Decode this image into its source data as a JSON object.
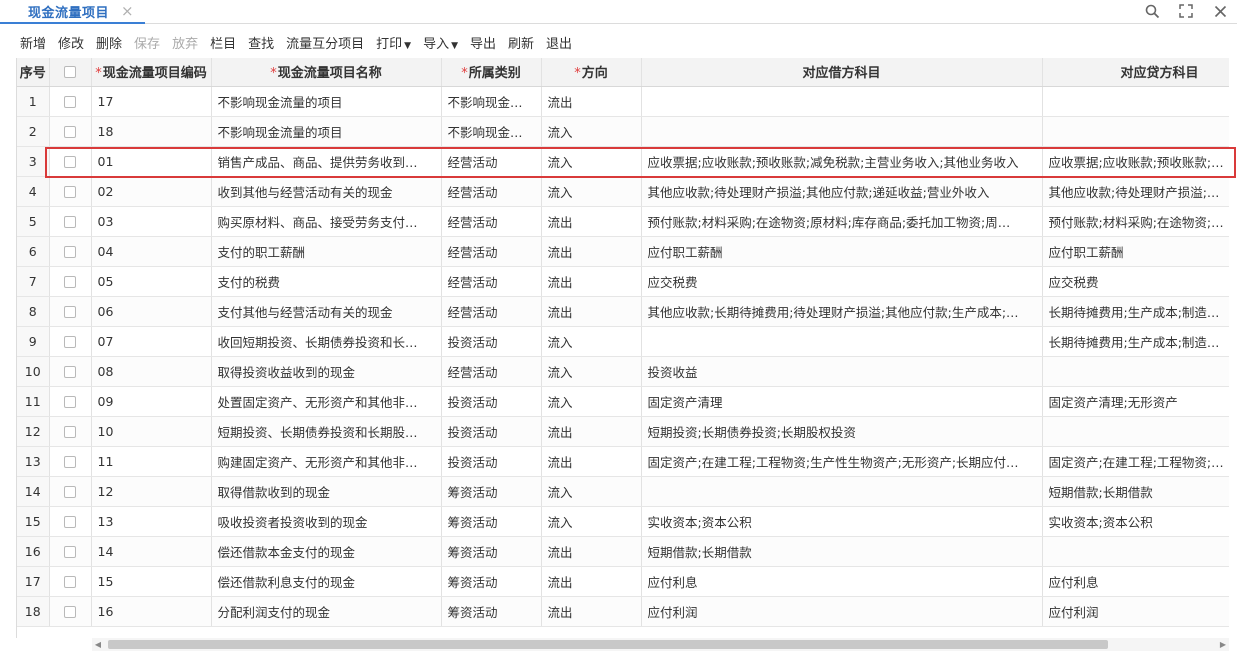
{
  "tab": {
    "title": "现金流量项目",
    "close": "×"
  },
  "toolbar": [
    {
      "label": "新增",
      "disabled": false,
      "dropdown": false
    },
    {
      "label": "修改",
      "disabled": false,
      "dropdown": false
    },
    {
      "label": "删除",
      "disabled": false,
      "dropdown": false
    },
    {
      "label": "保存",
      "disabled": true,
      "dropdown": false
    },
    {
      "label": "放弃",
      "disabled": true,
      "dropdown": false
    },
    {
      "label": "栏目",
      "disabled": false,
      "dropdown": false
    },
    {
      "label": "查找",
      "disabled": false,
      "dropdown": false
    },
    {
      "label": "流量互分项目",
      "disabled": false,
      "dropdown": false
    },
    {
      "label": "打印",
      "disabled": false,
      "dropdown": true
    },
    {
      "label": "导入",
      "disabled": false,
      "dropdown": true
    },
    {
      "label": "导出",
      "disabled": false,
      "dropdown": false
    },
    {
      "label": "刷新",
      "disabled": false,
      "dropdown": false
    },
    {
      "label": "退出",
      "disabled": false,
      "dropdown": false
    }
  ],
  "columns": [
    {
      "key": "seq",
      "label": "序号",
      "required": false
    },
    {
      "key": "chk",
      "label": "",
      "required": false
    },
    {
      "key": "code",
      "label": "现金流量项目编码",
      "required": true
    },
    {
      "key": "name",
      "label": "现金流量项目名称",
      "required": true
    },
    {
      "key": "category",
      "label": "所属类别",
      "required": true
    },
    {
      "key": "direction",
      "label": "方向",
      "required": true
    },
    {
      "key": "debit",
      "label": "对应借方科目",
      "required": false
    },
    {
      "key": "credit",
      "label": "对应贷方科目",
      "required": false
    }
  ],
  "rows": [
    {
      "seq": "1",
      "code": "17",
      "name": "不影响现金流量的项目",
      "category": "不影响现金…",
      "direction": "流出",
      "debit": "",
      "credit": ""
    },
    {
      "seq": "2",
      "code": "18",
      "name": "不影响现金流量的项目",
      "category": "不影响现金…",
      "direction": "流入",
      "debit": "",
      "credit": ""
    },
    {
      "seq": "3",
      "code": "01",
      "name": "销售产成品、商品、提供劳务收到…",
      "category": "经营活动",
      "direction": "流入",
      "debit": "应收票据;应收账款;预收账款;减免税款;主营业务收入;其他业务收入",
      "credit": "应收票据;应收账款;预收账款;…"
    },
    {
      "seq": "4",
      "code": "02",
      "name": "收到其他与经营活动有关的现金",
      "category": "经营活动",
      "direction": "流入",
      "debit": "其他应收款;待处理财产损溢;其他应付款;递延收益;营业外收入",
      "credit": "其他应收款;待处理财产损溢;…"
    },
    {
      "seq": "5",
      "code": "03",
      "name": "购买原材料、商品、接受劳务支付…",
      "category": "经营活动",
      "direction": "流出",
      "debit": "预付账款;材料采购;在途物资;原材料;库存商品;委托加工物资;周…",
      "credit": "预付账款;材料采购;在途物资;…"
    },
    {
      "seq": "6",
      "code": "04",
      "name": "支付的职工薪酬",
      "category": "经营活动",
      "direction": "流出",
      "debit": "应付职工薪酬",
      "credit": "应付职工薪酬"
    },
    {
      "seq": "7",
      "code": "05",
      "name": "支付的税费",
      "category": "经营活动",
      "direction": "流出",
      "debit": "应交税费",
      "credit": "应交税费"
    },
    {
      "seq": "8",
      "code": "06",
      "name": "支付其他与经营活动有关的现金",
      "category": "经营活动",
      "direction": "流出",
      "debit": "其他应收款;长期待摊费用;待处理财产损溢;其他应付款;生产成本;…",
      "credit": "长期待摊费用;生产成本;制造…"
    },
    {
      "seq": "9",
      "code": "07",
      "name": "收回短期投资、长期债券投资和长…",
      "category": "投资活动",
      "direction": "流入",
      "debit": "",
      "credit": "长期待摊费用;生产成本;制造…"
    },
    {
      "seq": "10",
      "code": "08",
      "name": "取得投资收益收到的现金",
      "category": "经营活动",
      "direction": "流入",
      "debit": "投资收益",
      "credit": ""
    },
    {
      "seq": "11",
      "code": "09",
      "name": "处置固定资产、无形资产和其他非…",
      "category": "投资活动",
      "direction": "流入",
      "debit": "固定资产清理",
      "credit": "固定资产清理;无形资产"
    },
    {
      "seq": "12",
      "code": "10",
      "name": "短期投资、长期债券投资和长期股…",
      "category": "投资活动",
      "direction": "流出",
      "debit": "短期投资;长期债券投资;长期股权投资",
      "credit": ""
    },
    {
      "seq": "13",
      "code": "11",
      "name": "购建固定资产、无形资产和其他非…",
      "category": "投资活动",
      "direction": "流出",
      "debit": "固定资产;在建工程;工程物资;生产性生物资产;无形资产;长期应付…",
      "credit": "固定资产;在建工程;工程物资;…"
    },
    {
      "seq": "14",
      "code": "12",
      "name": "取得借款收到的现金",
      "category": "筹资活动",
      "direction": "流入",
      "debit": "",
      "credit": "短期借款;长期借款"
    },
    {
      "seq": "15",
      "code": "13",
      "name": "吸收投资者投资收到的现金",
      "category": "筹资活动",
      "direction": "流入",
      "debit": "实收资本;资本公积",
      "credit": "实收资本;资本公积"
    },
    {
      "seq": "16",
      "code": "14",
      "name": "偿还借款本金支付的现金",
      "category": "筹资活动",
      "direction": "流出",
      "debit": "短期借款;长期借款",
      "credit": ""
    },
    {
      "seq": "17",
      "code": "15",
      "name": "偿还借款利息支付的现金",
      "category": "筹资活动",
      "direction": "流出",
      "debit": "应付利息",
      "credit": "应付利息"
    },
    {
      "seq": "18",
      "code": "16",
      "name": "分配利润支付的现金",
      "category": "筹资活动",
      "direction": "流出",
      "debit": "应付利润",
      "credit": "应付利润"
    }
  ],
  "icons": {
    "search": "search-icon",
    "maximize": "maximize-icon",
    "close": "close-icon"
  },
  "colors": {
    "accent": "#3a7fd5",
    "highlight": "#d93a3a",
    "required": "#e03c3c"
  }
}
